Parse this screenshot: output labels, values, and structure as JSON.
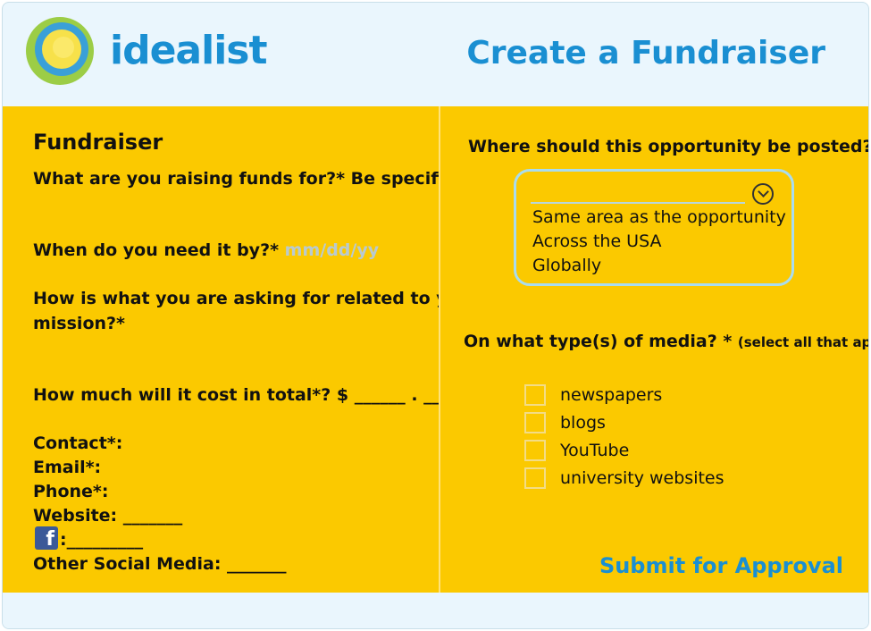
{
  "header": {
    "brand": "idealist",
    "title": "Create a Fundraiser"
  },
  "left": {
    "section_title": "Fundraiser",
    "q_funds": "What are you raising funds for?* Be specific.",
    "q_date": "When do you  need it by?*",
    "q_date_placeholder": "mm/dd/yy",
    "q_mission_line1": "How is what you are asking for related to your",
    "q_mission_line2": "mission?*",
    "q_cost": "How much will it cost in total*?  $ ______ . __",
    "contact": "Contact*:",
    "email": "Email*:",
    "phone": "Phone*:",
    "website": "Website: _______",
    "facebook": ":_________",
    "other_social": "Other Social Media: _______"
  },
  "right": {
    "q_posted": "Where should this opportunity be posted? *",
    "dropdown_options": [
      "Same area as the opportunity",
      "Across the USA",
      "Globally"
    ],
    "q_media": "On what type(s) of media? *",
    "q_media_hint": "(select all that apply)",
    "media_options": [
      "newspapers",
      "blogs",
      "YouTube",
      "university websites"
    ],
    "submit_label": "Submit for Approval"
  },
  "icons": {
    "logo": "idealist-logo-icon",
    "dropdown": "chevron-down-circle-icon",
    "facebook": "facebook-icon"
  },
  "colors": {
    "accent_blue": "#1a8fd2",
    "panel_yellow": "#fbc900",
    "header_bg": "#eaf6fd"
  }
}
